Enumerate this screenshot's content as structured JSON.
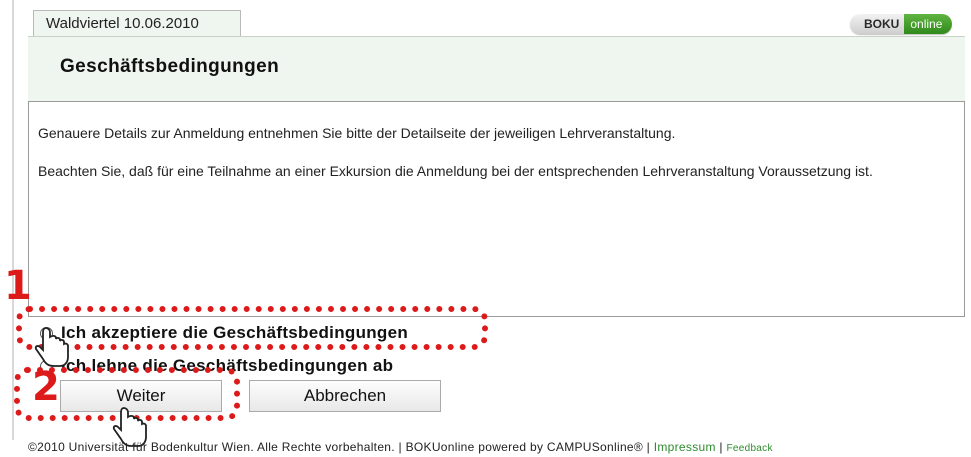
{
  "tab": {
    "label": "Waldviertel 10.06.2010"
  },
  "brand": {
    "part1": "BOKU",
    "part2": "online"
  },
  "page": {
    "title": "Geschäftsbedingungen"
  },
  "info": {
    "paragraph1": "Genauere Details zur Anmeldung entnehmen Sie bitte der Detailseite der jeweiligen Lehrveranstaltung.",
    "paragraph2": "Beachten Sie, daß für eine Teilnahme an einer Exkursion die Anmeldung bei der entsprechenden Lehrveranstaltung Voraussetzung ist."
  },
  "terms": {
    "accept_label": "Ich akzeptiere die Geschäftsbedingungen",
    "decline_label": "Ich lehne die Geschäftsbedingungen ab",
    "selected": "accept"
  },
  "buttons": {
    "next": "Weiter",
    "cancel": "Abbrechen"
  },
  "annotations": {
    "step1": "1",
    "step2": "2",
    "color": "#dd1a1a"
  },
  "footer": {
    "copyright": "©2010 Universität für Bodenkultur Wien. Alle Rechte vorbehalten. | BOKUonline powered by CAMPUSonline® | ",
    "impressum": "Impressum",
    "separator": " | ",
    "feedback": "Feedback"
  }
}
